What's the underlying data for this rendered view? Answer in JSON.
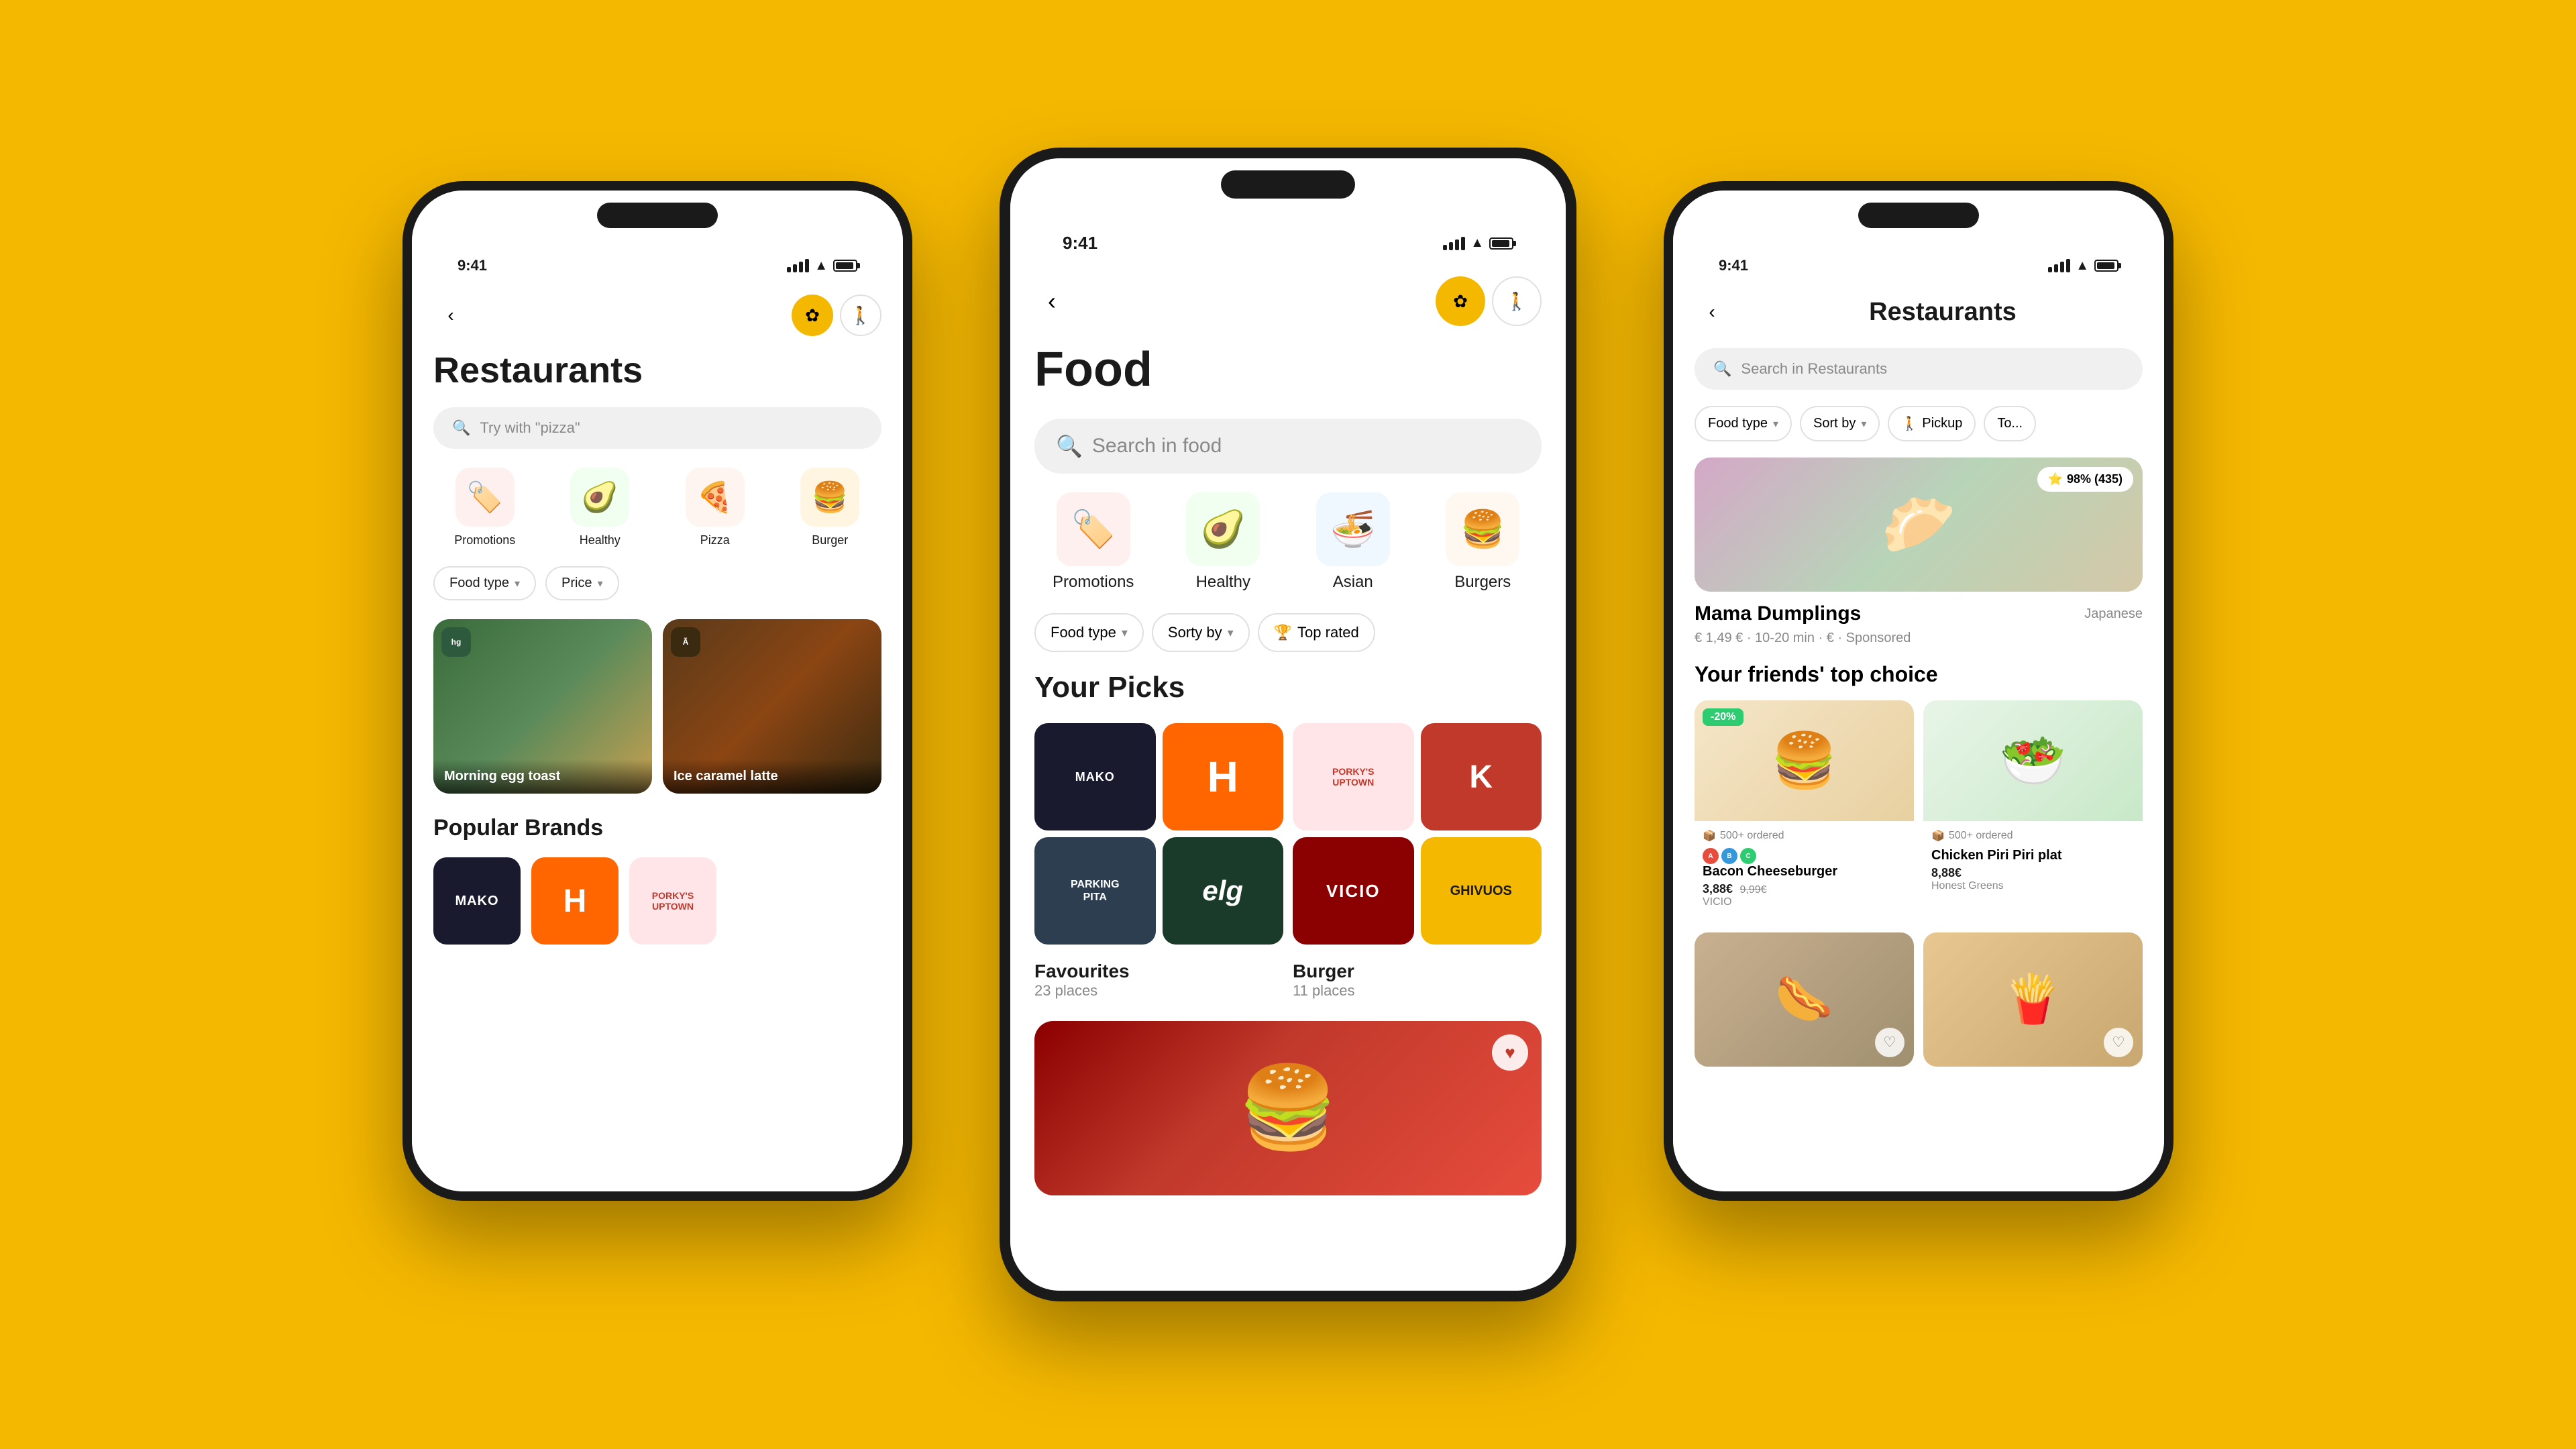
{
  "background_color": "#F5B800",
  "phones": {
    "left": {
      "time": "9:41",
      "title": "Restaurants",
      "search_placeholder": "Try with \"pizza\"",
      "categories": [
        {
          "label": "Promotions",
          "emoji": "🏷️",
          "bg_class": "category-promotions"
        },
        {
          "label": "Healthy",
          "emoji": "🥑",
          "bg_class": "category-healthy"
        },
        {
          "label": "Pizza",
          "emoji": "🍕",
          "bg_class": "category-pizza"
        },
        {
          "label": "Burger",
          "emoji": "🍔",
          "bg_class": "category-burger2"
        }
      ],
      "filters": [
        "Food type",
        "Price"
      ],
      "restaurants": [
        {
          "name": "Morning egg toast",
          "logo_text": "hg",
          "logo_bg": "#2d5a3d"
        },
        {
          "name": "Ice caramel latte",
          "logo_text": "A",
          "logo_bg": "#5a3a1a"
        }
      ],
      "popular_brands_title": "Popular Brands",
      "brands": [
        "MAKO",
        "H",
        "PORKY'S"
      ]
    },
    "center": {
      "time": "9:41",
      "title": "Food",
      "search_placeholder": "Search in food",
      "categories": [
        {
          "label": "Promotions",
          "emoji": "🏷️",
          "bg_class": "category-promotions"
        },
        {
          "label": "Healthy",
          "emoji": "🥑",
          "bg_class": "category-healthy"
        },
        {
          "label": "Asian",
          "emoji": "🍜",
          "bg_class": "category-asian"
        },
        {
          "label": "Burgers",
          "emoji": "🍔",
          "bg_class": "category-burgers"
        }
      ],
      "filter_chips": [
        "Food type",
        "Sorty by",
        "Top rated"
      ],
      "your_picks_title": "Your Picks",
      "picks": [
        {
          "name": "MAKO",
          "style": "pick-mako"
        },
        {
          "name": "H",
          "style": "pick-h"
        },
        {
          "name": "PORKY'S",
          "style": "pick-porkys"
        },
        {
          "name": "K",
          "style": "pick-k"
        },
        {
          "name": "PARKING PITA",
          "style": "pick-parking"
        },
        {
          "name": "elg",
          "style": "pick-elg"
        },
        {
          "name": "VICIO",
          "style": "pick-vicio"
        },
        {
          "name": "GHIVUOS",
          "style": "pick-ghivuos"
        }
      ],
      "pick_groups": [
        {
          "title": "Favourites",
          "count": "23 places"
        },
        {
          "title": "Burger",
          "count": "11 places"
        }
      ]
    },
    "right": {
      "time": "9:41",
      "title": "Restaurants",
      "search_placeholder": "Search in Restaurants",
      "filter_chips": [
        "Food type",
        "Sort by",
        "Pickup",
        "To..."
      ],
      "featured_restaurant": {
        "name": "Mama Dumplings",
        "category": "Japanese",
        "rating": "98% (435)",
        "meta": "€ 1,49 € · 10-20 min · € · Sponsored"
      },
      "friends_title": "Your friends' top choice",
      "friend_items": [
        {
          "name": "Bacon Cheeseburger",
          "price": "3,88€",
          "old_price": "9,99€",
          "restaurant": "VICIO",
          "ordered": "500+ ordered",
          "discount": "-20%"
        },
        {
          "name": "Chicken Piri Piri plat",
          "price": "8,88€",
          "restaurant": "Honest Greens",
          "ordered": "500+ ordered"
        }
      ]
    }
  }
}
